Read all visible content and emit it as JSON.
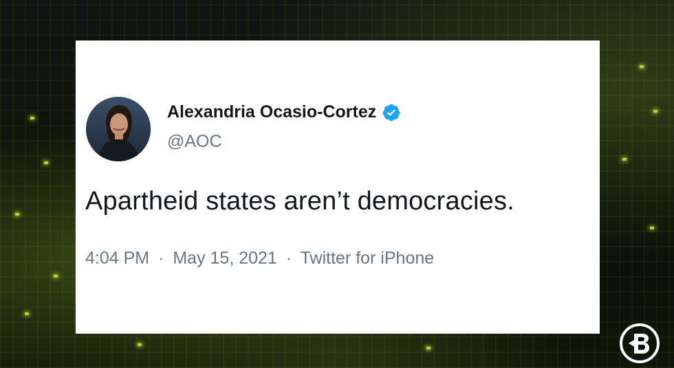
{
  "tweet": {
    "display_name": "Alexandria Ocasio-Cortez",
    "handle": "@AOC",
    "verified_icon": "verified-badge-icon",
    "text": "Apartheid states aren’t democracies.",
    "time": "4:04 PM",
    "date": "May 15, 2021",
    "source": "Twitter for iPhone",
    "separator": "·"
  },
  "brand": {
    "logo_icon": "blaze-media-logo-icon"
  },
  "colors": {
    "card_bg": "#ffffff",
    "name_text": "#14171a",
    "muted_text": "#657786",
    "verified_blue": "#1da1f2",
    "bg_accent": "#b9d43a"
  }
}
